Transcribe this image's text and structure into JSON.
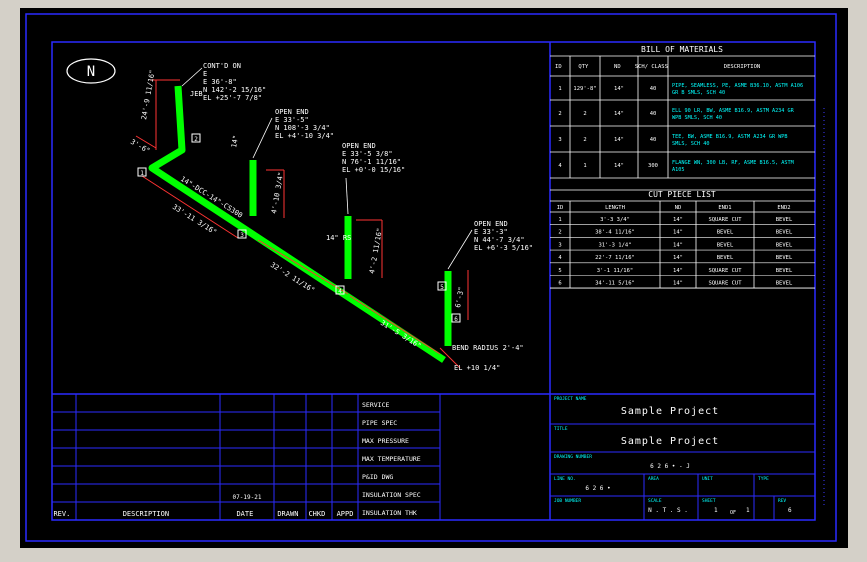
{
  "north_label": "N",
  "bom": {
    "title": "BILL OF MATERIALS",
    "headers": [
      "ID",
      "QTY",
      "ND",
      "SCH/\nCLASS",
      "DESCRIPTION"
    ],
    "rows": [
      {
        "id": "1",
        "qty": "129'-8\"",
        "nd": "14\"",
        "sch": "40",
        "desc": [
          "PIPE, SEAMLESS, PE, ASME B36.10, ASTM A106",
          "GR B SMLS, SCH 40"
        ]
      },
      {
        "id": "2",
        "qty": "2",
        "nd": "14\"",
        "sch": "40",
        "desc": [
          "ELL 90 LR, BW, ASME B16.9, ASTM A234 GR",
          "WPB SMLS, SCH 40"
        ]
      },
      {
        "id": "3",
        "qty": "2",
        "nd": "14\"",
        "sch": "40",
        "desc": [
          "TEE, BW, ASME B16.9, ASTM A234 GR WPB",
          "SMLS, SCH 40"
        ]
      },
      {
        "id": "4",
        "qty": "1",
        "nd": "14\"",
        "sch": "300",
        "desc": [
          "FLANGE WN, 300 LB, RF, ASME B16.5, ASTM",
          "A105"
        ]
      }
    ]
  },
  "cut": {
    "title": "CUT PIECE LIST",
    "headers": [
      "ID",
      "LENGTH",
      "ND",
      "END1",
      "END2"
    ],
    "rows": [
      [
        "1",
        "3'-3 3/4\"",
        "14\"",
        "SQUARE CUT",
        "BEVEL"
      ],
      [
        "2",
        "38'-4 11/16\"",
        "14\"",
        "BEVEL",
        "BEVEL"
      ],
      [
        "3",
        "31'-3 1/4\"",
        "14\"",
        "BEVEL",
        "BEVEL"
      ],
      [
        "4",
        "22'-7 11/16\"",
        "14\"",
        "BEVEL",
        "BEVEL"
      ],
      [
        "5",
        "3'-1 11/16\"",
        "14\"",
        "SQUARE CUT",
        "BEVEL"
      ],
      [
        "6",
        "34'-11 5/16\"",
        "14\"",
        "SQUARE CUT",
        "BEVEL"
      ]
    ]
  },
  "callouts": [
    [
      "CONT'D ON",
      "E",
      "E 36'-8\"",
      "N 142'-2 15/16\"",
      "EL +25'-7 7/8\""
    ],
    [
      "OPEN END",
      "E 33'-5\"",
      "N 108'-3 3/4\"",
      "EL +4'-10 3/4\""
    ],
    [
      "OPEN END",
      "E 33'-5 3/8\"",
      "N 76'-1 11/16\"",
      "EL +0'-0 15/16\""
    ],
    [
      "OPEN END",
      "E 33'-3\"",
      "N 44'-7 3/4\"",
      "EL +6'-3 5/16\""
    ]
  ],
  "dims": {
    "d1": "24'-9 11/16\"",
    "d2": "3'-6\"",
    "d3": "33'-11 3/16\"",
    "d4": "32'-2 11/16\"",
    "d5": "31'-5 3/16\"",
    "d6": "4'-10 3/4\"",
    "d7": "4'-2 11/16\"",
    "d8": "6'-3\"",
    "pipe_label": "14\"-DCC-14\"-CS300",
    "size1": "14\"",
    "size2": "14\" RS",
    "bend": "BEND RADIUS 2'-4\"",
    "el": "EL +10 1/4\"",
    "jeb": "JEB"
  },
  "marks": [
    "1",
    "2",
    "3",
    "4",
    "5",
    "6"
  ],
  "revision": {
    "headers": [
      "REV.",
      "DESCRIPTION",
      "DATE",
      "DRAWN",
      "CHKD",
      "APPD"
    ],
    "date_value": "07-19-21"
  },
  "specs": [
    "SERVICE",
    "PIPE SPEC",
    "MAX PRESSURE",
    "MAX TEMPERATURE",
    "P&ID DWG",
    "INSULATION SPEC",
    "INSULATION THK"
  ],
  "title_block": {
    "project_name_label": "PROJECT NAME",
    "project_name": "Sample Project",
    "title_label": "TITLE",
    "title": "Sample Project",
    "drawing_number_label": "DRAWING NUMBER",
    "drawing_number": "6 2 6 • - J",
    "line_no_label": "LINE NO.",
    "line_no": "6 2 6 •",
    "area_label": "AREA",
    "unit_label": "UNIT",
    "type_label": "TYPE",
    "job_number_label": "JOB NUMBER",
    "scale_label": "SCALE",
    "scale": "N . T . S .",
    "sheet_label": "SHEET",
    "sheet": "1",
    "of": "OF",
    "sheet_total": "1",
    "rev_label": "REV",
    "rev": "6"
  },
  "colors": {
    "sheet": "#000000",
    "border": "#2b2bff",
    "pipe": "#00ff00",
    "dimension": "#ff3333",
    "cyan": "#00ffff"
  }
}
